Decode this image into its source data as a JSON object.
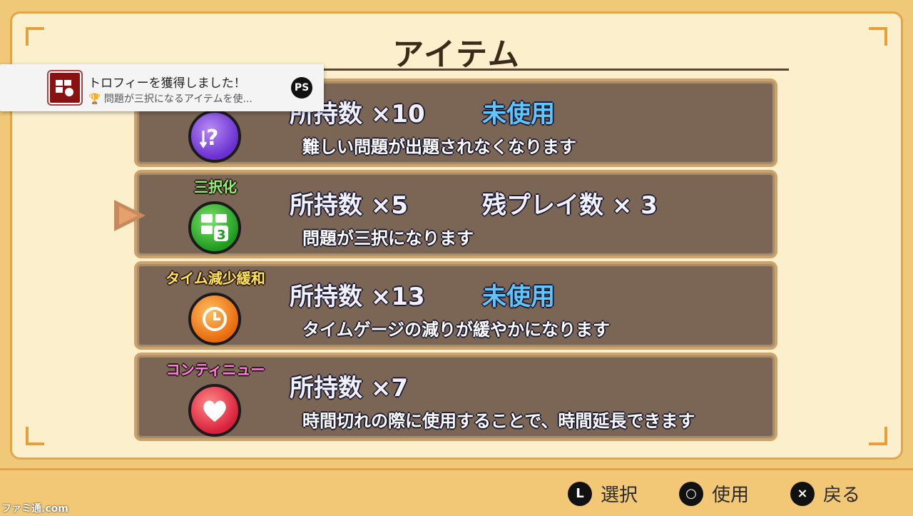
{
  "title": "アイテム",
  "items": [
    {
      "name": "",
      "quantity": "所持数 ×10",
      "status": "未使用",
      "description": "難しい問題が出題されなくなります",
      "icon": "difficulty-icon",
      "name_color": "#ffffff"
    },
    {
      "name": "三択化",
      "quantity": "所持数 ×5",
      "status": "残プレイ数 × 3",
      "description": "問題が三択になります",
      "icon": "three-choice-icon",
      "name_color": "#8df07a"
    },
    {
      "name": "タイム減少緩和",
      "quantity": "所持数 ×13",
      "status": "未使用",
      "description": "タイムゲージの減りが緩やかになります",
      "icon": "clock-icon",
      "name_color": "#ffe35a"
    },
    {
      "name": "コンティニュー",
      "quantity": "所持数 ×7",
      "status": "",
      "description": "時間切れの際に使用することで、時間延長できます",
      "icon": "heart-icon",
      "name_color": "#ff7de8"
    }
  ],
  "footer": {
    "select_btn": "L",
    "select_label": "選択",
    "use_btn": "○",
    "use_label": "使用",
    "back_btn": "×",
    "back_label": "戻る"
  },
  "toast": {
    "title": "トロフィーを獲得しました！",
    "subtitle": "問題が三択になるアイテムを使...",
    "logo": "PS"
  },
  "watermark": "ファミ通.com"
}
